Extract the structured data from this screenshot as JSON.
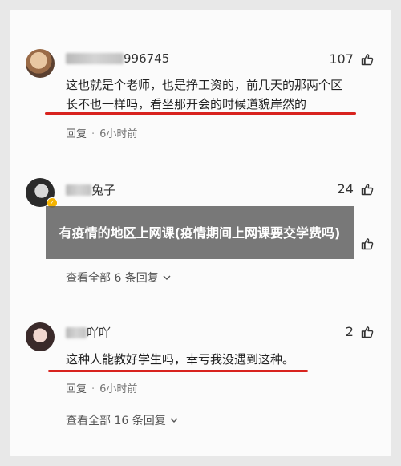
{
  "comments": [
    {
      "username_visible": "996745",
      "likes": "107",
      "text_line1": "这也就是个老师，也是挣工资的，前几天的那两个区",
      "text_line2": "长不也一样吗，看坐那开会的时候道貌岸然的",
      "reply_label": "回复",
      "time": "6小时前"
    },
    {
      "username_visible": "兔子",
      "likes": "24",
      "view_all": "查看全部 6 条回复"
    },
    {
      "username_visible": "吖吖",
      "likes": "2",
      "text": "这种人能教好学生吗，幸亏我没遇到这种。",
      "reply_label": "回复",
      "time": "6小时前",
      "view_all": "查看全部 16 条回复"
    }
  ],
  "overlay_title": "有疫情的地区上网课(疫情期间上网课要交学费吗)",
  "colors": {
    "underline": "#d8231e",
    "overlay": "#5a5a5a",
    "badge": "#f5b400"
  },
  "icons": [
    "thumbs-up-icon",
    "chevron-down-icon",
    "verified-badge-icon"
  ]
}
